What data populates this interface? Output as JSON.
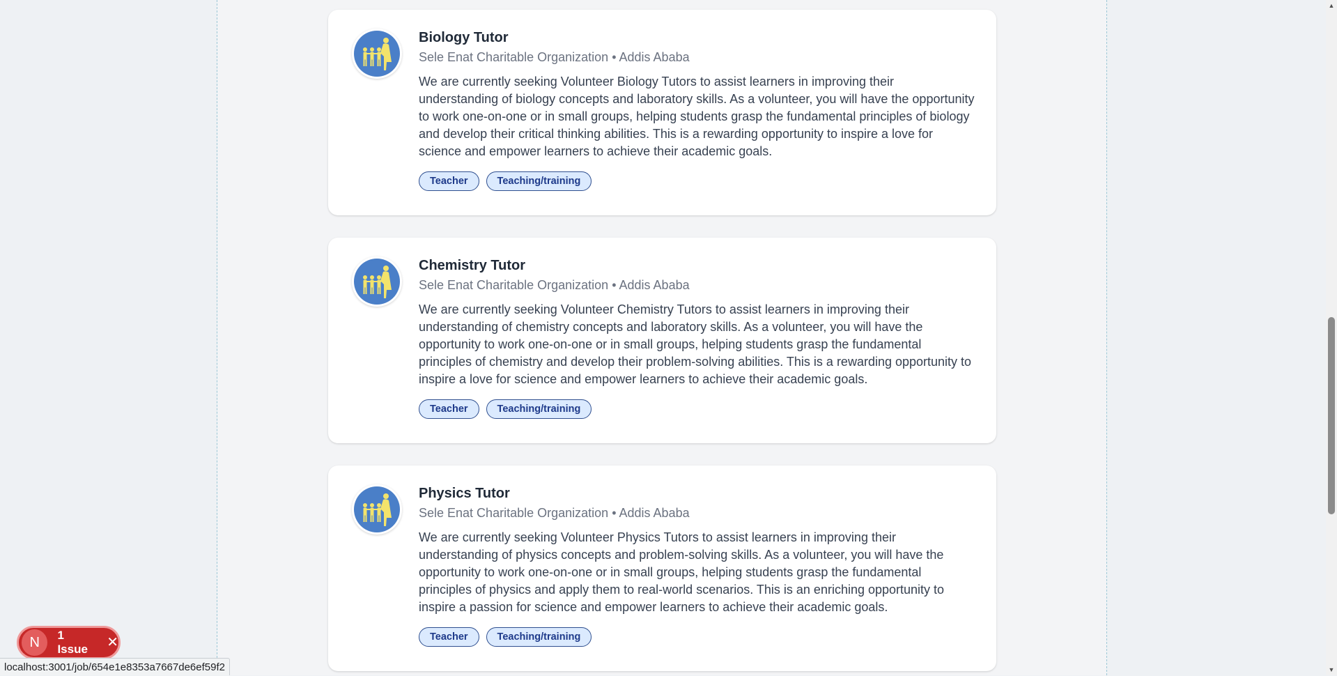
{
  "jobs": [
    {
      "title": "Biology Tutor",
      "organization": "Sele Enat Charitable Organization",
      "separator": "•",
      "location": "Addis Ababa",
      "description": "We are currently seeking Volunteer Biology Tutors to assist learners in improving their understanding of biology concepts and laboratory skills. As a volunteer, you will have the opportunity to work one-on-one or in small groups, helping students grasp the fundamental principles of biology and develop their critical thinking abilities. This is a rewarding opportunity to inspire a love for science and empower learners to achieve their academic goals.",
      "tags": [
        "Teacher",
        "Teaching/training"
      ]
    },
    {
      "title": "Chemistry Tutor",
      "organization": "Sele Enat Charitable Organization",
      "separator": "•",
      "location": "Addis Ababa",
      "description": "We are currently seeking Volunteer Chemistry Tutors to assist learners in improving their understanding of chemistry concepts and laboratory skills. As a volunteer, you will have the opportunity to work one-on-one or in small groups, helping students grasp the fundamental principles of chemistry and develop their problem-solving abilities. This is a rewarding opportunity to inspire a love for science and empower learners to achieve their academic goals.",
      "tags": [
        "Teacher",
        "Teaching/training"
      ]
    },
    {
      "title": "Physics Tutor",
      "organization": "Sele Enat Charitable Organization",
      "separator": "•",
      "location": "Addis Ababa",
      "description": "We are currently seeking Volunteer Physics Tutors to assist learners in improving their understanding of physics concepts and problem-solving skills. As a volunteer, you will have the opportunity to work one-on-one or in small groups, helping students grasp the fundamental principles of physics and apply them to real-world scenarios. This is an enriching opportunity to inspire a passion for science and empower learners to achieve their academic goals.",
      "tags": [
        "Teacher",
        "Teaching/training"
      ]
    }
  ],
  "issue_badge": {
    "avatar_letter": "N",
    "label": "1 Issue",
    "close_glyph": "✕",
    "icon": "close-icon"
  },
  "status_bar": {
    "url": "localhost:3001/job/654e1e8353a7667de6ef59f2"
  },
  "colors": {
    "tag_bg": "#dbeafe",
    "tag_border": "#2f4f8f",
    "tag_text": "#1e3a8a",
    "logo_circle": "#4a7fc8",
    "logo_figures": "#f3e36b",
    "issue_bg": "#c62828"
  }
}
